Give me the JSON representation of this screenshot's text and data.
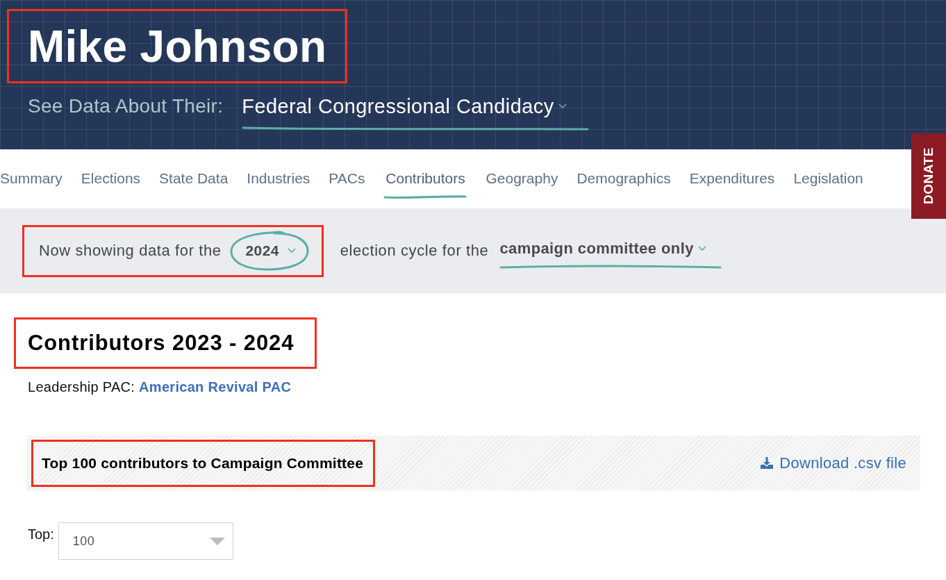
{
  "header": {
    "title": {
      "text": "Mike Johnson",
      "highlighted": true
    },
    "data_label": "See Data About Their:",
    "data_select": {
      "value": "Federal Congressional Candidacy"
    }
  },
  "nav": {
    "tabs": [
      {
        "label": "Summary",
        "selected": false
      },
      {
        "label": "Elections",
        "selected": false
      },
      {
        "label": "State Data",
        "selected": false
      },
      {
        "label": "Industries",
        "selected": false
      },
      {
        "label": "PACs",
        "selected": false
      },
      {
        "label": "Contributors",
        "selected": true
      },
      {
        "label": "Geography",
        "selected": false
      },
      {
        "label": "Demographics",
        "selected": false
      },
      {
        "label": "Expenditures",
        "selected": false
      },
      {
        "label": "Legislation",
        "selected": false
      }
    ],
    "donate": "DONATE"
  },
  "cycle_bar": {
    "cycle_group": {
      "highlighted": true,
      "prefix": "Now showing data for the",
      "select": {
        "value": "2024"
      }
    },
    "middle_text": "election cycle for the",
    "committee_select": {
      "value": "campaign committee only"
    }
  },
  "content": {
    "heading": {
      "text": "Contributors 2023 - 2024",
      "highlighted": true
    },
    "leadership": {
      "label": "Leadership PAC:",
      "link": "American Revival PAC"
    },
    "section": {
      "title": {
        "text": "Top 100 contributors to Campaign Committee",
        "highlighted": true
      },
      "download": "Download .csv file"
    },
    "top_filter": {
      "label": "Top:",
      "value": "100"
    }
  }
}
